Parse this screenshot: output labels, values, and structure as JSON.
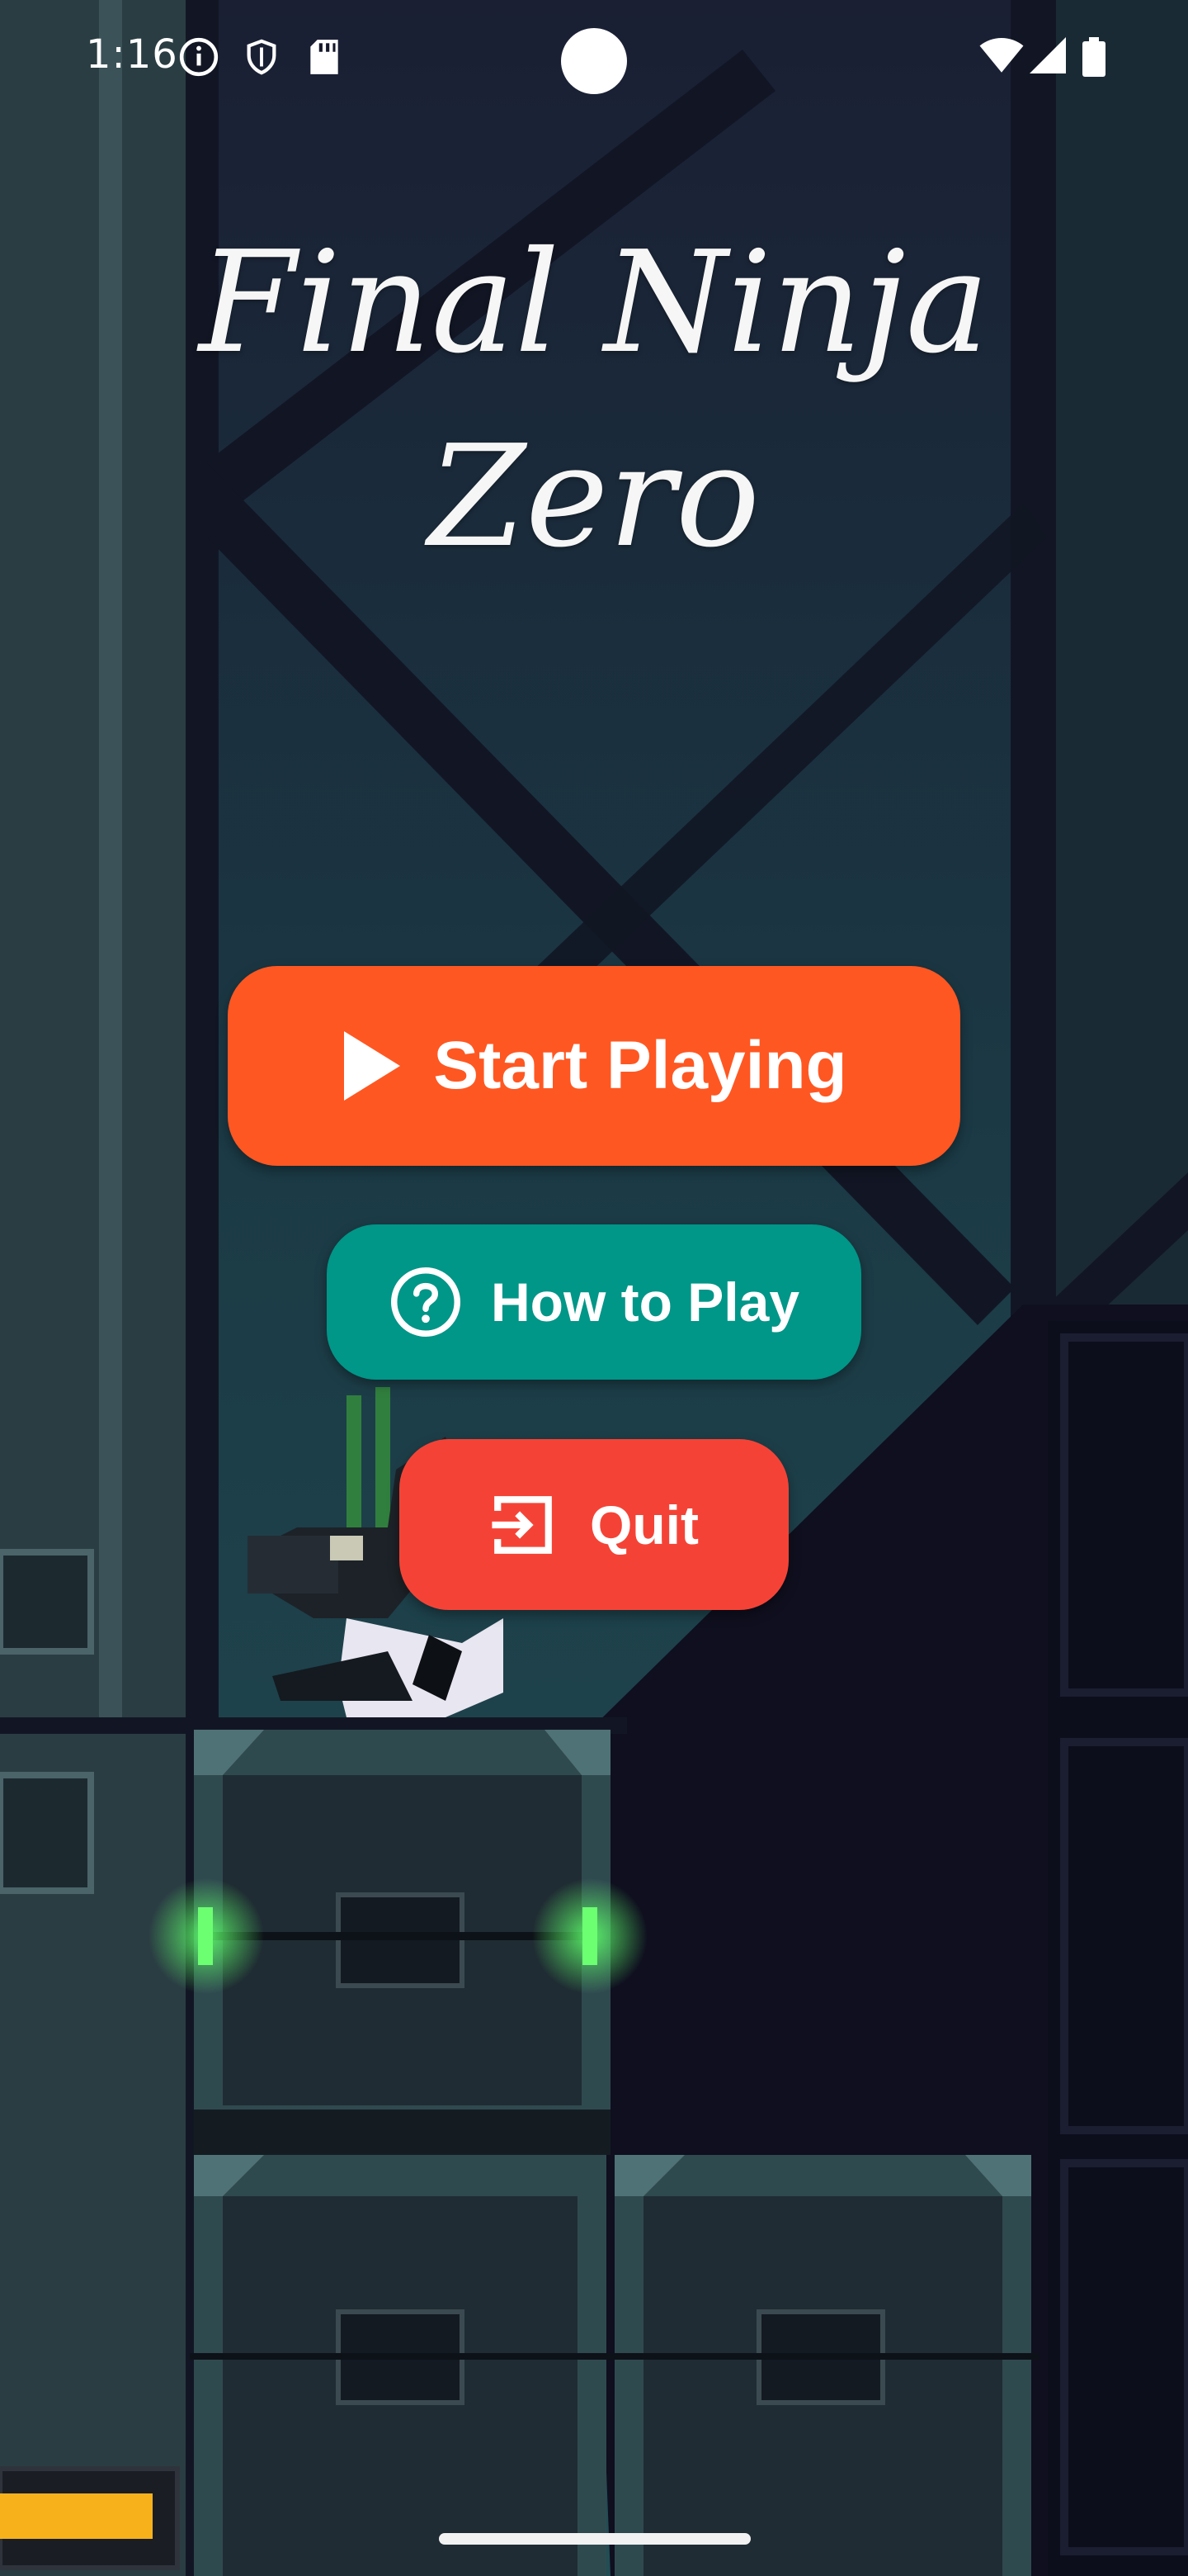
{
  "status_bar": {
    "time": "1:16",
    "icons_left": [
      "info-icon",
      "shield-icon",
      "sd-card-icon"
    ],
    "icons_right": [
      "wifi-icon",
      "cellular-signal-icon",
      "battery-icon"
    ]
  },
  "game": {
    "title_line1": "Final Ninja",
    "title_line2": "Zero"
  },
  "menu": {
    "start_label": "Start Playing",
    "start_icon": "play-icon",
    "how_label": "How to Play",
    "how_icon": "help-circle-icon",
    "quit_label": "Quit",
    "quit_icon": "exit-icon"
  },
  "colors": {
    "start": "#ff5722",
    "how": "#009688",
    "quit": "#f44336",
    "sky": "#1c3f4a",
    "building": "#2b3a40"
  }
}
